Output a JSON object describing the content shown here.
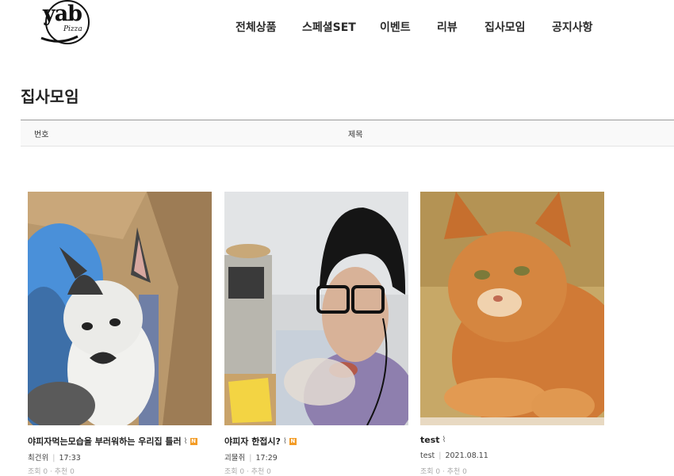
{
  "logo": {
    "text": "yab",
    "sub": "Pizza"
  },
  "nav": [
    "전체상품",
    "스페셜SET",
    "이벤트",
    "리뷰",
    "집사모임",
    "공지사항"
  ],
  "board": {
    "title": "집사모임",
    "columns": {
      "no": "번호",
      "subject": "제목"
    }
  },
  "posts": [
    {
      "title": "야피자먹는모습을 부러워하는 우리집 틀러",
      "badge": "N",
      "author": "최건위",
      "time": "17:33",
      "stats": "조회 0 · 추천 0"
    },
    {
      "title": "야피자 한접시?",
      "badge": "N",
      "author": "괴물쥐",
      "time": "17:29",
      "stats": "조회 0 · 추천 0"
    },
    {
      "title": "test",
      "badge": "",
      "author": "test",
      "time": "2021.08.11",
      "stats": "조회 0 · 추천 0"
    }
  ],
  "icons": {
    "attachment": "paperclip-icon",
    "new": "new-badge"
  },
  "colors": {
    "badge": "#f39c26",
    "head_line": "#9a9a9a"
  }
}
